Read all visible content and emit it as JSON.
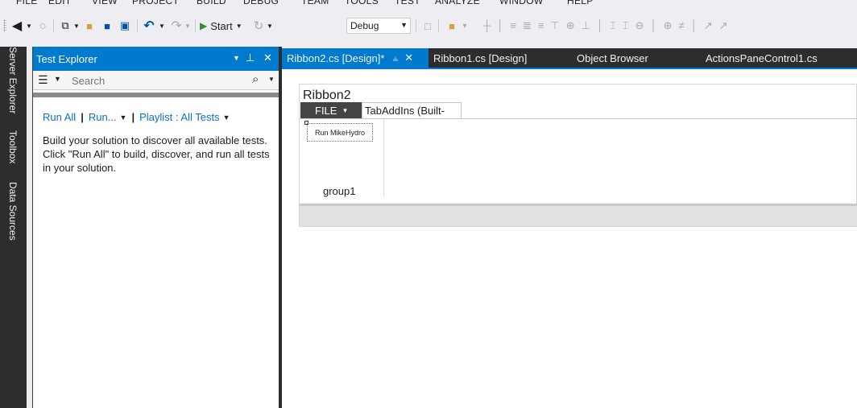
{
  "menu": [
    "FILE",
    "EDIT",
    "VIEW",
    "PROJECT",
    "BUILD",
    "DEBUG",
    "TEAM",
    "TOOLS",
    "TEST",
    "ANALYZE",
    "WINDOW",
    "HELP"
  ],
  "toolbar": {
    "start_label": "Start",
    "config_value": "Debug",
    "icons": [
      "back-icon",
      "forward-icon",
      "new-project-icon",
      "open-folder-icon",
      "save-icon",
      "save-all-icon",
      "undo-icon",
      "redo-icon",
      "start-icon",
      "attach-icon",
      "find-icon",
      "align-icons"
    ]
  },
  "side_tabs": [
    "Server Explorer",
    "Toolbox",
    "Data Sources"
  ],
  "test_explorer": {
    "title": "Test Explorer",
    "search_placeholder": "Search",
    "run_all": "Run All",
    "run": "Run...",
    "playlist": "Playlist : All Tests",
    "message": "Build your solution to discover all available tests. Click \"Run All\" to build, discover, and run all tests in your solution."
  },
  "doc_tabs": [
    {
      "label": "Ribbon2.cs [Design]*",
      "active": true
    },
    {
      "label": "Ribbon1.cs [Design]",
      "active": false
    },
    {
      "label": "Object Browser",
      "active": false
    },
    {
      "label": "ActionsPaneControl1.cs",
      "active": false
    }
  ],
  "ribbon": {
    "title": "Ribbon2",
    "file_tab": "FILE",
    "tab_label": "TabAddIns (Built-",
    "button_label": "Run MikeHydro",
    "group_label": "group1"
  },
  "colors": {
    "accent": "#007acc",
    "dark_chrome": "#2d2d30",
    "link": "#0e70c0",
    "start_green": "#388a34"
  }
}
